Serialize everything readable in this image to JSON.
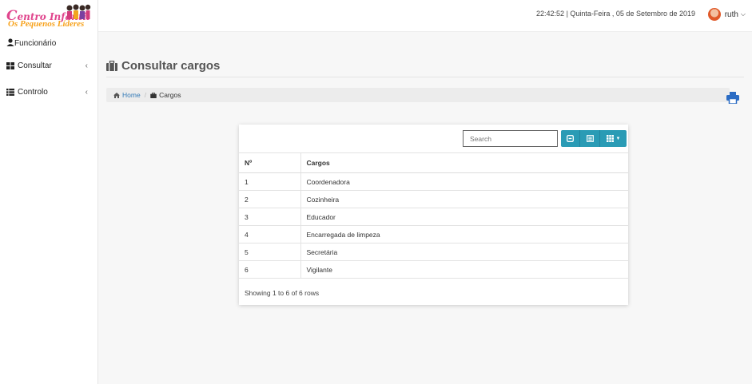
{
  "logo": {
    "line1_a": "C",
    "line1_b": "entro Infantil",
    "line2": "Os Pequenos Líderes"
  },
  "sidebar": {
    "user_label": "Funcionário",
    "items": [
      {
        "label": "Consultar",
        "icon": "th-large-icon"
      },
      {
        "label": "Controlo",
        "icon": "th-list-icon"
      }
    ]
  },
  "topbar": {
    "datetime": "22:42:52 | Quinta-Feira , 05 de Setembro de 2019",
    "username": "ruth"
  },
  "page": {
    "title": "Consultar cargos",
    "breadcrumb": {
      "home": "Home",
      "current": "Cargos"
    }
  },
  "table": {
    "search_placeholder": "Search",
    "columns": [
      "Nº",
      "Cargos"
    ],
    "rows": [
      [
        "1",
        "Coordenadora"
      ],
      [
        "2",
        "Cozinheira"
      ],
      [
        "3",
        "Educador"
      ],
      [
        "4",
        "Encarregada de limpeza"
      ],
      [
        "5",
        "Secretária"
      ],
      [
        "6",
        "Vigilante"
      ]
    ],
    "pagination_info": "Showing 1 to 6 of 6 rows"
  },
  "colors": {
    "accent": "#2a9bb5",
    "link": "#337ab7",
    "print": "#2b6cc4",
    "logo_pink": "#e0458d",
    "logo_orange": "#f7a21b"
  }
}
